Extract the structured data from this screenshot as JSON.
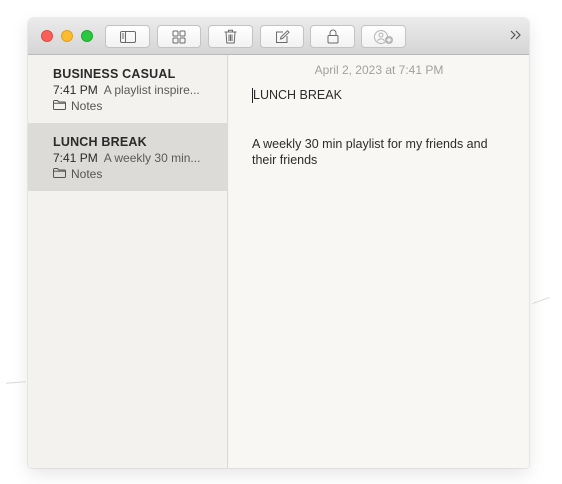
{
  "window": {
    "toolbar": {
      "buttons": [
        {
          "name": "sidebar-toggle",
          "icon": "sidebar-icon"
        },
        {
          "name": "gallery-view",
          "icon": "grid-icon"
        },
        {
          "name": "delete",
          "icon": "trash-icon"
        },
        {
          "name": "compose",
          "icon": "compose-icon"
        },
        {
          "name": "lock",
          "icon": "lock-icon"
        },
        {
          "name": "add-people",
          "icon": "add-people-icon"
        }
      ],
      "overflow_icon": "chevron-double-right-icon",
      "traffic_lights": {
        "close": "#fc5f57",
        "minimize": "#fdbc2e",
        "zoom": "#28c840"
      }
    }
  },
  "notes": [
    {
      "title": "BUSINESS CASUAL",
      "time": "7:41 PM",
      "snippet": "A playlist inspire...",
      "folder": "Notes",
      "selected": false
    },
    {
      "title": "LUNCH BREAK",
      "time": "7:41 PM",
      "snippet": "A weekly 30 min...",
      "folder": "Notes",
      "selected": true
    }
  ],
  "editor": {
    "date": "April 2, 2023 at 7:41 PM",
    "title": "LUNCH BREAK",
    "body": "A weekly 30 min playlist for my friends and their friends"
  },
  "colors": {
    "selected_row": "#dcdbd7",
    "date_text": "#a3a19c"
  }
}
